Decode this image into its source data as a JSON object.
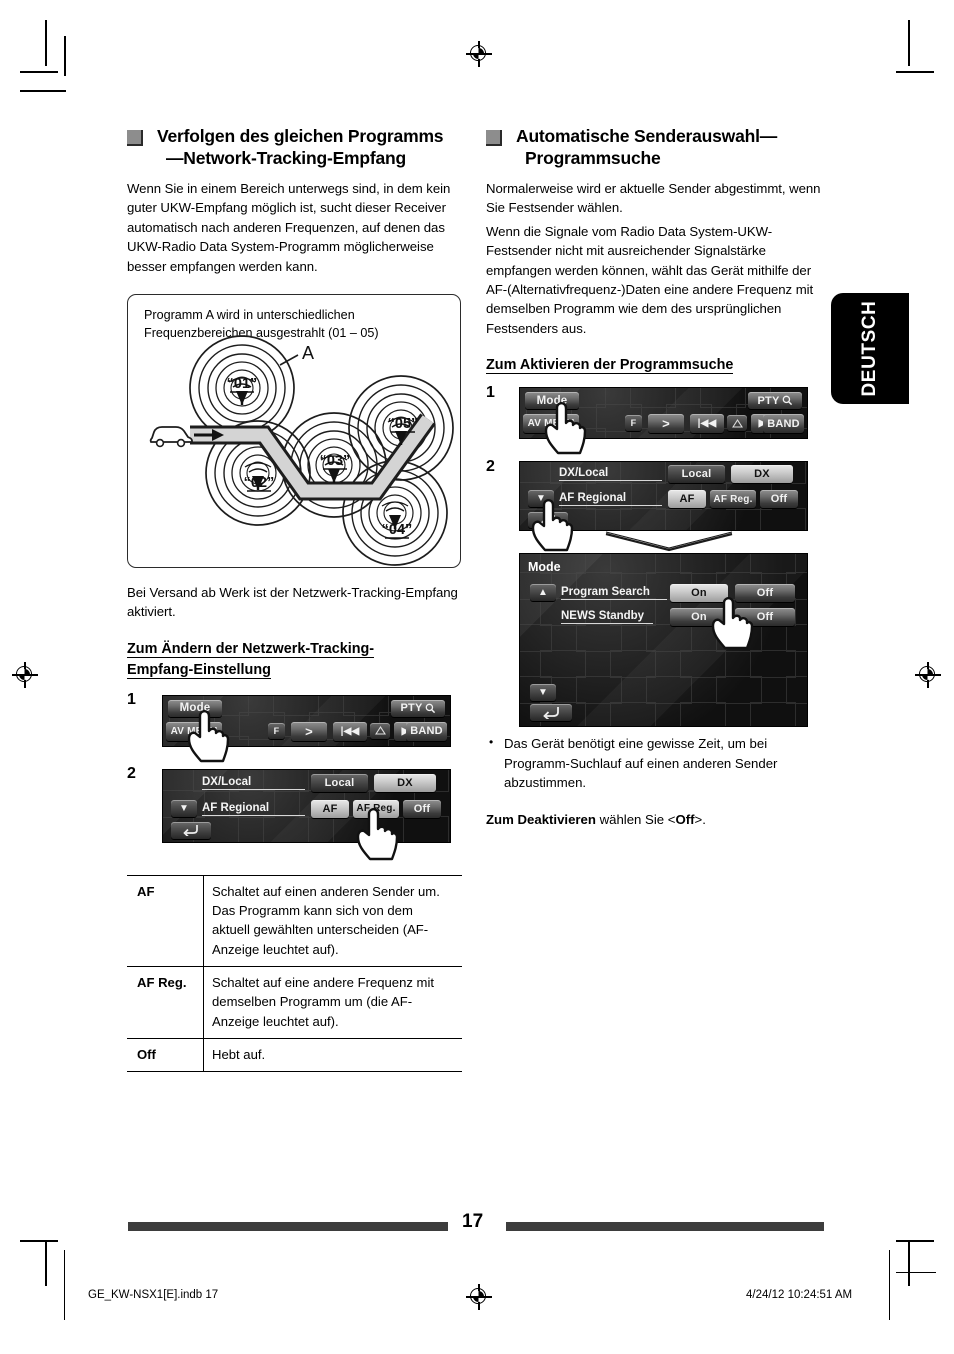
{
  "page": {
    "number": "17",
    "language_tab": "DEUTSCH",
    "footer_file": "GE_KW-NSX1[E].indb   17",
    "footer_date": "4/24/12   10:24:51 AM"
  },
  "left": {
    "heading": "Verfolgen des gleichen Programms —Network-Tracking-Empfang",
    "heading_line1": "Verfolgen des gleichen Programms",
    "heading_line2": "—Network-Tracking-Empfang",
    "intro": "Wenn Sie in einem Bereich unterwegs sind, in dem kein guter UKW-Empfang möglich ist, sucht dieser Receiver automatisch nach anderen Frequenzen, auf denen das UKW-Radio Data System-Programm möglicherweise besser empfangen werden kann.",
    "diagram": {
      "caption_line1": "Programm A wird in unterschiedlichen",
      "caption_line2": "Frequenzbereichen ausgestrahlt (01 – 05)",
      "label_a": "A",
      "zones": [
        "“01”",
        "“02”",
        "“03”",
        "“04”",
        "“05”"
      ]
    },
    "after_diagram": "Bei Versand ab Werk ist der Netzwerk-Tracking-Empfang aktiviert.",
    "subheading_line1": "Zum Ändern der Netzwerk-Tracking-",
    "subheading_line2": "Empfang-Einstellung",
    "step1_num": "1",
    "step2_num": "2",
    "table": {
      "rows": [
        {
          "key": "AF",
          "desc": "Schaltet auf einen anderen Sender um. Das Programm kann sich von dem aktuell gewählten unterscheiden (AF-Anzeige leuchtet auf)."
        },
        {
          "key": "AF Reg.",
          "desc": "Schaltet auf eine andere Frequenz mit demselben Programm um (die AF-Anzeige leuchtet auf)."
        },
        {
          "key": "Off",
          "desc": "Hebt auf."
        }
      ]
    }
  },
  "right": {
    "heading_line1": "Automatische Senderauswahl—",
    "heading_line2": "Programmsuche",
    "para1": "Normalerweise wird er aktuelle Sender abgestimmt, wenn Sie Festsender wählen.",
    "para2": "Wenn die Signale vom Radio Data System-UKW-Festsender nicht mit ausreichender Signalstärke empfangen werden können, wählt das Gerät mithilfe der AF-(Alternativfrequenz-)Daten eine andere Frequenz mit demselben Programm wie dem des ursprünglichen Festsenders aus.",
    "subheading": "Zum Aktivieren der Programmsuche",
    "step1_num": "1",
    "step2_num": "2",
    "bullet1": "Das Gerät benötigt eine gewisse Zeit, um bei Programm-Suchlauf auf einen anderen Sender abzustimmen.",
    "note_bold": "Zum Deaktivieren",
    "note_rest": " wählen Sie <",
    "note_value": "Off",
    "note_end": ">."
  },
  "panels": {
    "mode_bar": {
      "mode_label": "Mode",
      "av_menu_label": "AV MENU",
      "pty_label": "PTY",
      "band_label": "BAND",
      "keys": [
        "F",
        ">",
        "|◀◀",
        "disp",
        "▶▶|"
      ]
    },
    "dx_local": {
      "row1_label": "DX/Local",
      "row1_options": [
        "Local",
        "DX"
      ],
      "row1_selected": "DX",
      "row2_label": "AF Regional",
      "row2_options": [
        "AF",
        "AF Reg.",
        "Off"
      ],
      "row2_selected_left": "AF",
      "row2_selected_right": "AF Reg.",
      "down_arrow": "▼",
      "back_arrow": "↰"
    },
    "mode_menu": {
      "title": "Mode",
      "rows": [
        {
          "label": "Program Search",
          "options": [
            "On",
            "Off"
          ],
          "selected": "On"
        },
        {
          "label": "NEWS Standby",
          "options": [
            "On",
            "Off"
          ],
          "selected": ""
        }
      ],
      "up_arrow": "▲",
      "down_arrow": "▼",
      "back_arrow": "↰"
    }
  },
  "colors": {
    "heading_square": "#8d8d8d",
    "lcd_bg": "#1b1b1b",
    "tab_bg": "#000000",
    "footer_rule": "#3d3d3d"
  }
}
